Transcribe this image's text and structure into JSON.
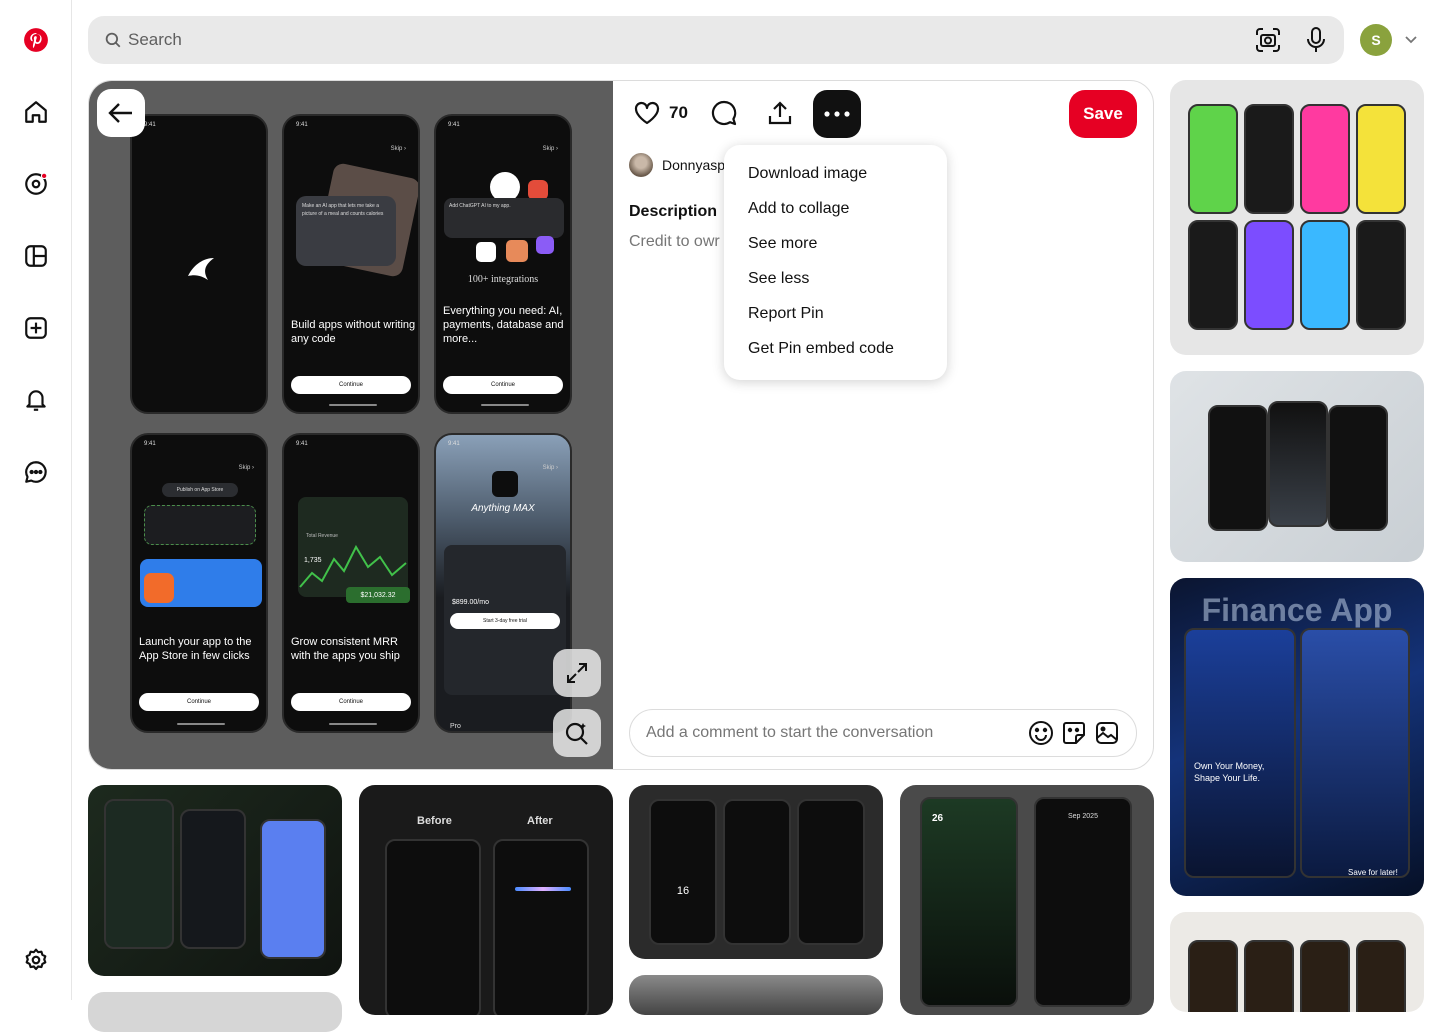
{
  "search": {
    "placeholder": "Search"
  },
  "account": {
    "initial": "S"
  },
  "pin": {
    "like_count": "70",
    "save_label": "Save",
    "author": "Donnyasp",
    "description_title": "Description",
    "description_text": "Credit to owr",
    "comment_placeholder": "Add a comment to start the conversation",
    "screens": [
      {
        "caption": ""
      },
      {
        "caption": "Build apps without writing any code",
        "button": "Continue",
        "body": "Make an AI app that lets me take a picture of a meal and counts calories"
      },
      {
        "caption": "Everything you need: AI, payments, database and more...",
        "button": "Continue",
        "body": "Add ChatGPT AI to my app.",
        "badge": "100+ integrations"
      },
      {
        "caption": "Launch your app to the App Store in few clicks",
        "button": "Continue",
        "body": "Publish on App Store"
      },
      {
        "caption": "Grow consistent MRR with the apps you ship",
        "button": "Continue",
        "body": "Total Revenue",
        "stat1": "1,735",
        "stat2": "$21,032.32"
      },
      {
        "caption": "",
        "title": "Anything MAX",
        "price": "$899.00/mo",
        "button": "Start 3-day free trial",
        "footer": "Pro"
      }
    ]
  },
  "menu": {
    "items": [
      "Download image",
      "Add to collage",
      "See more",
      "See less",
      "Report Pin",
      "Get Pin embed code"
    ]
  },
  "feed": {
    "tile_before": "Before",
    "tile_after": "After",
    "finance_title": "Finance App",
    "finance_heading": "Own Your Money, Shape Your Life.",
    "finance_save": "Save for later!",
    "calendar_day": "26",
    "calendar_month": "Sep 2025",
    "timer_value": "16"
  },
  "colors": {
    "brand": "#e60023",
    "avatar": "#8aa23d"
  }
}
